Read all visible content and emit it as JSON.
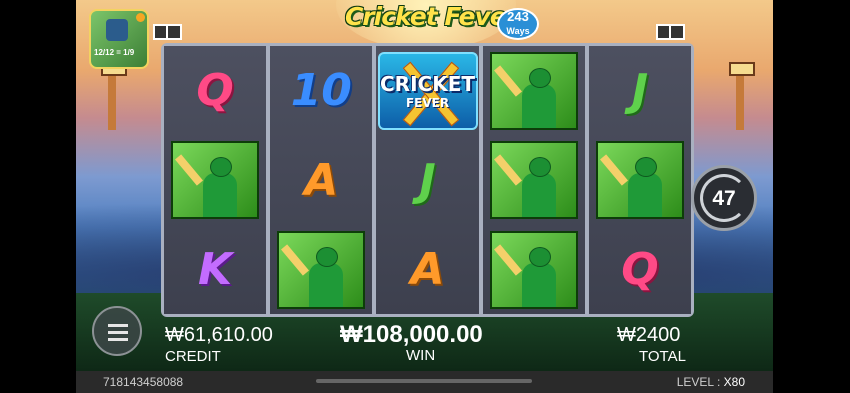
{
  "game": {
    "logo_main": "Cricket Fever",
    "logo_ways_num": "243",
    "logo_ways_word": "Ways",
    "thumb_text": "12/12 = 1/9"
  },
  "reels": [
    [
      {
        "type": "letter",
        "symbol": "Q"
      },
      {
        "type": "batter"
      },
      {
        "type": "letter",
        "symbol": "K"
      }
    ],
    [
      {
        "type": "letter",
        "symbol": "10"
      },
      {
        "type": "letter",
        "symbol": "A"
      },
      {
        "type": "batter"
      }
    ],
    [
      {
        "type": "wild",
        "line1": "CRICKET",
        "line2": "FEVER"
      },
      {
        "type": "letter",
        "symbol": "J"
      },
      {
        "type": "letter",
        "symbol": "A"
      }
    ],
    [
      {
        "type": "batter"
      },
      {
        "type": "batter"
      },
      {
        "type": "batter"
      }
    ],
    [
      {
        "type": "letter",
        "symbol": "J"
      },
      {
        "type": "batter"
      },
      {
        "type": "letter",
        "symbol": "Q"
      }
    ]
  ],
  "spin_button": {
    "count": "47"
  },
  "credit": {
    "value": "₩61,610.00",
    "label": "CREDIT"
  },
  "win": {
    "value": "₩108,000.00",
    "label": "WIN"
  },
  "total": {
    "value": "₩2400",
    "label": "TOTAL"
  },
  "footer": {
    "id": "718143458088",
    "level_label": "LEVEL :",
    "level_value": "X80"
  },
  "colors": {
    "Q": "#ff4a86",
    "10": "#3a8dff",
    "A": "#ff9a2a",
    "J": "#5fd14c",
    "K": "#c36cff"
  }
}
